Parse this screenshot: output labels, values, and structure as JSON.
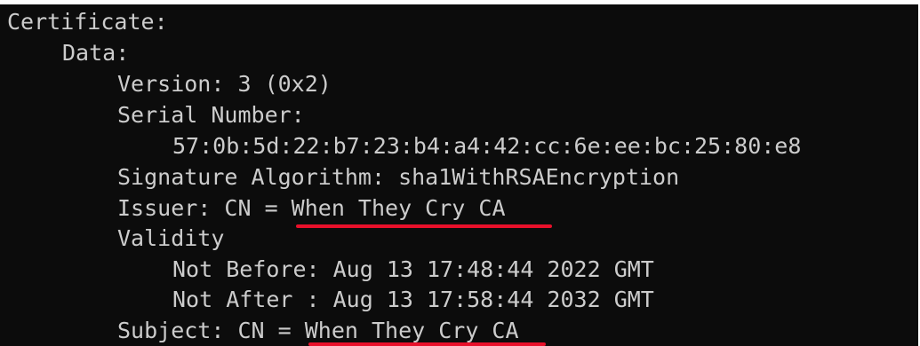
{
  "cert": {
    "header": "Certificate:",
    "data_label": "Data:",
    "version": "Version: 3 (0x2)",
    "serial_label": "Serial Number:",
    "serial_value": "57:0b:5d:22:b7:23:b4:a4:42:cc:6e:ee:bc:25:80:e8",
    "signature_algorithm": "Signature Algorithm: sha1WithRSAEncryption",
    "issuer_prefix": "Issuer: CN = ",
    "issuer_cn": "When They Cry CA",
    "validity_label": "Validity",
    "not_before": "Not Before: Aug 13 17:48:44 2022 GMT",
    "not_after": "Not After : Aug 13 17:58:44 2032 GMT",
    "subject_prefix": "Subject: CN = ",
    "subject_cn": "When They Cry CA"
  },
  "colors": {
    "terminal_background": "#0c0c0c",
    "terminal_text": "#cccccc",
    "annotation_underline": "#e8102a"
  }
}
